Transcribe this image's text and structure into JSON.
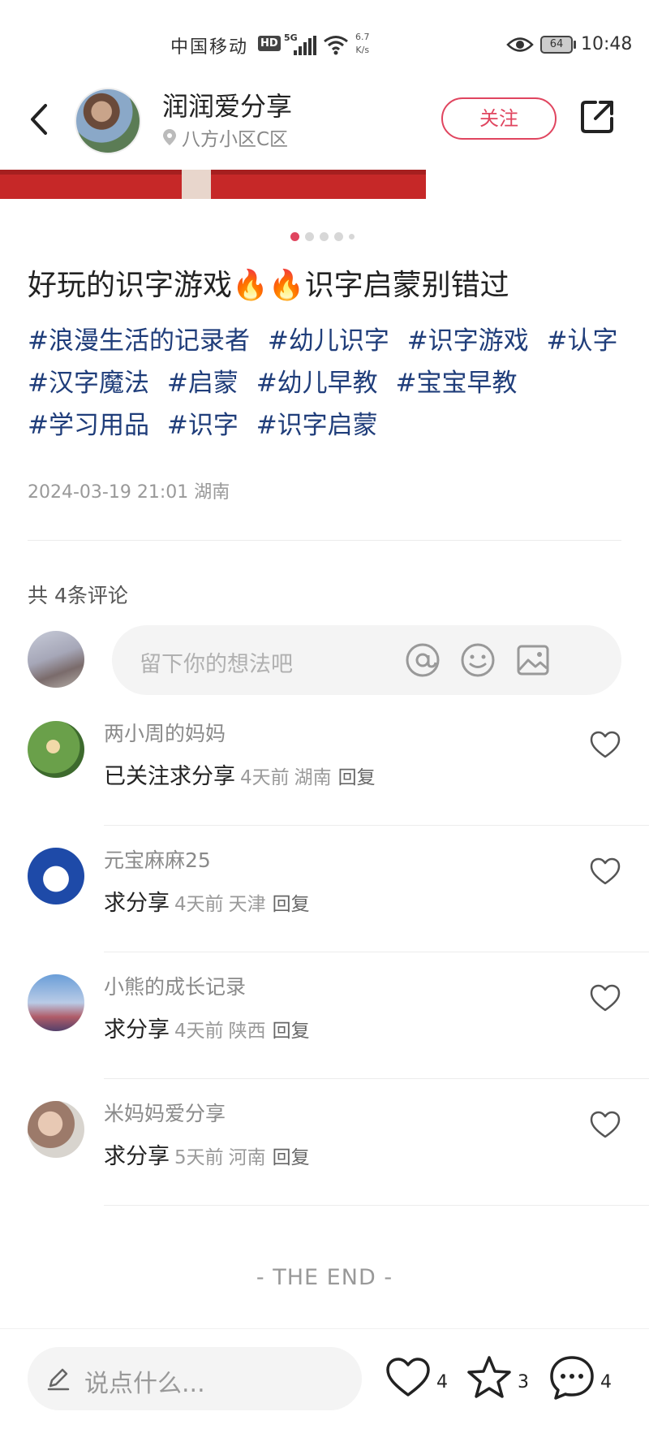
{
  "status_bar": {
    "carrier": "中国移动",
    "hd": "HD",
    "network": "5G",
    "speed_value": "6.7",
    "speed_unit": "K/s",
    "battery": "64",
    "time": "10:48"
  },
  "header": {
    "author_name": "润润爱分享",
    "location": "八方小区C区",
    "follow_label": "关注"
  },
  "carousel": {
    "total_pages": 5,
    "active_page": 1
  },
  "note": {
    "title": "好玩的识字游戏🔥🔥识字启蒙别错过",
    "tags": [
      "#浪漫生活的记录者",
      "#幼儿识字",
      "#识字游戏",
      "#认字",
      "#汉字魔法",
      "#启蒙",
      "#幼儿早教",
      "#宝宝早教",
      "#学习用品",
      "#识字",
      "#识字启蒙"
    ],
    "datetime": "2024-03-19 21:01",
    "region": "湖南"
  },
  "comments_section": {
    "count_label": "共 4条评论",
    "input_placeholder": "留下你的想法吧",
    "comments": [
      {
        "user": "两小周的妈妈",
        "text": "已关注求分享",
        "time": "4天前",
        "region": "湖南",
        "reply": "回复"
      },
      {
        "user": "元宝麻麻25",
        "text": "求分享",
        "time": "4天前",
        "region": "天津",
        "reply": "回复"
      },
      {
        "user": "小熊的成长记录",
        "text": "求分享",
        "time": "4天前",
        "region": "陕西",
        "reply": "回复"
      },
      {
        "user": "米妈妈爱分享",
        "text": "求分享",
        "time": "5天前",
        "region": "河南",
        "reply": "回复"
      }
    ],
    "end_label": "- THE END -"
  },
  "bottom_bar": {
    "input_placeholder": "说点什么...",
    "likes": "4",
    "collects": "3",
    "comments": "4"
  },
  "colors": {
    "accent": "#e0455f",
    "tag": "#1f3d7a",
    "muted": "#999999"
  }
}
